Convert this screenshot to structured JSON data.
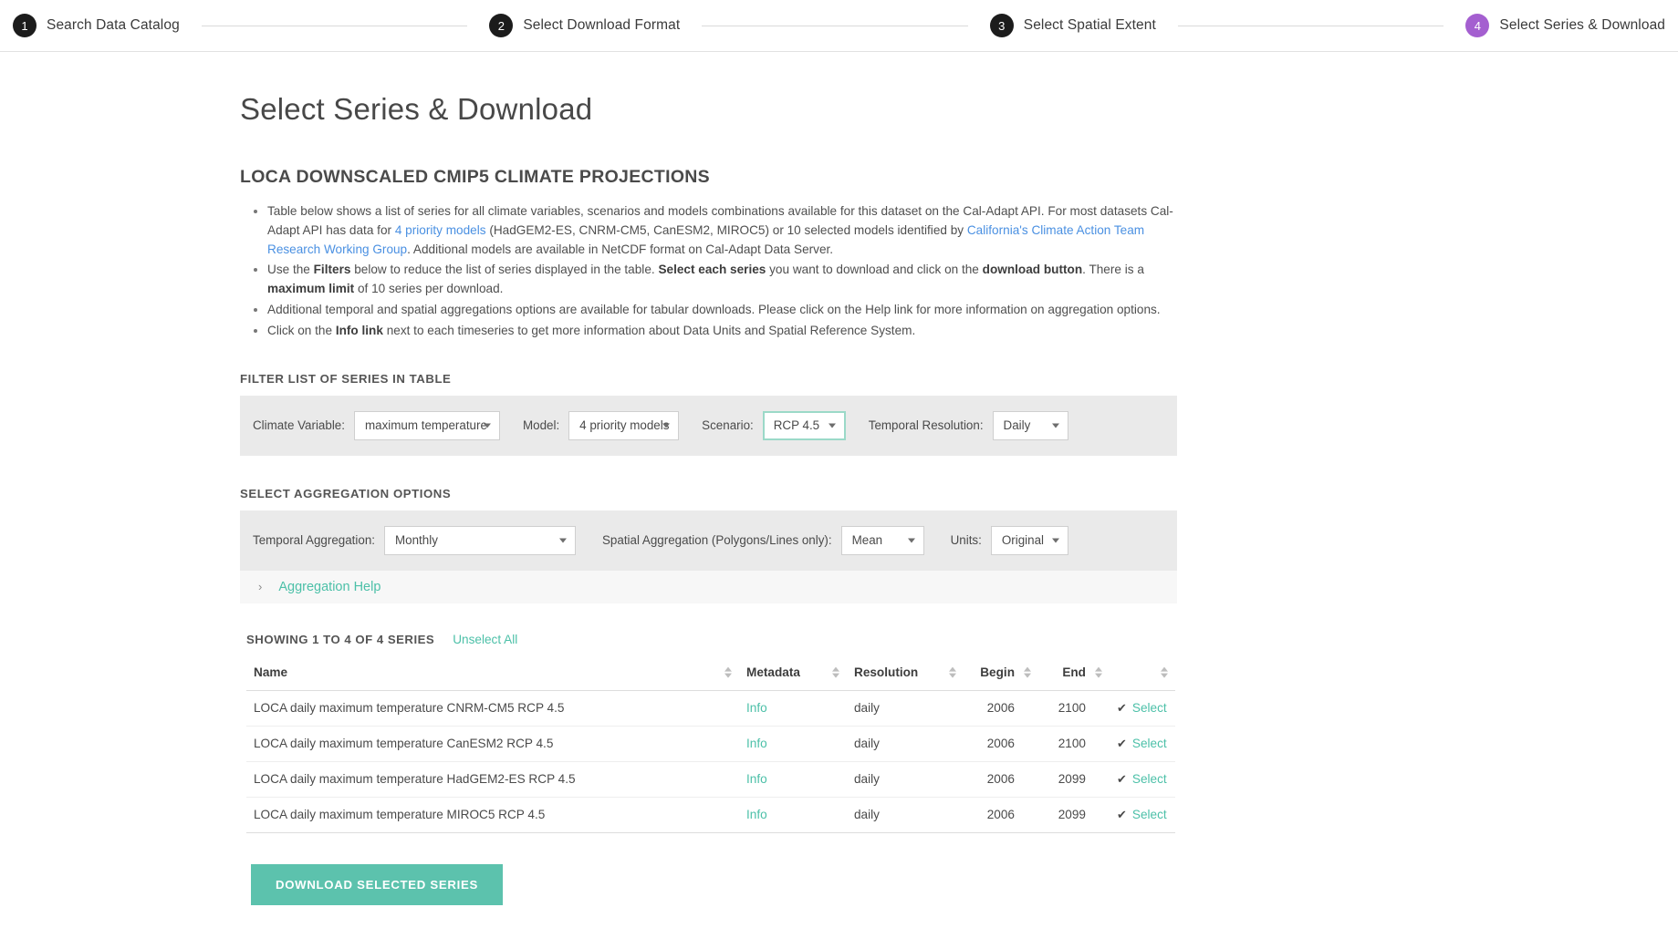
{
  "stepper": {
    "steps": [
      {
        "num": "1",
        "label": "Search Data Catalog",
        "active": false
      },
      {
        "num": "2",
        "label": "Select Download Format",
        "active": false
      },
      {
        "num": "3",
        "label": "Select Spatial Extent",
        "active": false
      },
      {
        "num": "4",
        "label": "Select Series & Download",
        "active": true
      }
    ],
    "active_color": "#a45fd0",
    "inactive_color": "#1c1c1c"
  },
  "page": {
    "title": "Select Series & Download",
    "dataset_title": "LOCA DOWNSCALED CMIP5 CLIMATE PROJECTIONS"
  },
  "notes": {
    "b1_a": "Table below shows a list of series for all climate variables, scenarios and models combinations available for this dataset on the Cal-Adapt API. For most datasets Cal-Adapt API has data for ",
    "b1_link1": "4 priority models",
    "b1_b": " (HadGEM2-ES, CNRM-CM5, CanESM2, MIROC5) or 10 selected models identified by ",
    "b1_link2": "California's Climate Action Team Research Working Group",
    "b1_c": ". Additional models are available in NetCDF format on Cal-Adapt Data Server.",
    "b2_a": "Use the ",
    "b2_bold1": "Filters",
    "b2_b": " below to reduce the list of series displayed in the table. ",
    "b2_bold2": "Select each series",
    "b2_c": " you want to download and click on the ",
    "b2_bold3": "download button",
    "b2_d": ". There is a ",
    "b2_bold4": "maximum limit",
    "b2_e": " of 10 series per download.",
    "b3": "Additional temporal and spatial aggregations options are available for tabular downloads. Please click on the Help link for more information on aggregation options.",
    "b4_a": "Click on the ",
    "b4_bold": "Info link",
    "b4_b": " next to each timeseries to get more information about Data Units and Spatial Reference System."
  },
  "filters": {
    "section_label": "FILTER LIST OF SERIES IN TABLE",
    "climate_variable": {
      "label": "Climate Variable:",
      "value": "maximum temperature"
    },
    "model": {
      "label": "Model:",
      "value": "4 priority models"
    },
    "scenario": {
      "label": "Scenario:",
      "value": "RCP 4.5",
      "focused": true,
      "focus_color": "#9bd9c8"
    },
    "temporal_resolution": {
      "label": "Temporal Resolution:",
      "value": "Daily"
    }
  },
  "aggregation": {
    "section_label": "SELECT AGGREGATION OPTIONS",
    "temporal": {
      "label": "Temporal Aggregation:",
      "value": "Monthly"
    },
    "spatial": {
      "label": "Spatial Aggregation (Polygons/Lines only):",
      "value": "Mean"
    },
    "units": {
      "label": "Units:",
      "value": "Original"
    },
    "help_link": "Aggregation Help",
    "help_chevron": "›"
  },
  "table": {
    "showing_text": "SHOWING 1 TO 4 OF 4 SERIES",
    "unselect_label": "Unselect All",
    "columns": [
      "Name",
      "Metadata",
      "Resolution",
      "Begin",
      "End",
      ""
    ],
    "rows": [
      {
        "name": "LOCA daily maximum temperature CNRM-CM5 RCP 4.5",
        "metadata": "Info",
        "resolution": "daily",
        "begin": "2006",
        "end": "2100",
        "select": "Select",
        "checked": true
      },
      {
        "name": "LOCA daily maximum temperature CanESM2 RCP 4.5",
        "metadata": "Info",
        "resolution": "daily",
        "begin": "2006",
        "end": "2100",
        "select": "Select",
        "checked": true
      },
      {
        "name": "LOCA daily maximum temperature HadGEM2-ES RCP 4.5",
        "metadata": "Info",
        "resolution": "daily",
        "begin": "2006",
        "end": "2099",
        "select": "Select",
        "checked": true
      },
      {
        "name": "LOCA daily maximum temperature MIROC5 RCP 4.5",
        "metadata": "Info",
        "resolution": "daily",
        "begin": "2006",
        "end": "2099",
        "select": "Select",
        "checked": true
      }
    ],
    "check_glyph": "✔"
  },
  "download": {
    "label": "DOWNLOAD SELECTED SERIES",
    "color": "#5cc2ad"
  },
  "colors": {
    "accent_teal": "#4cc0a8",
    "link_blue": "#4a90e2",
    "panel_gray": "#eaeaea",
    "help_gray": "#f7f7f7"
  }
}
